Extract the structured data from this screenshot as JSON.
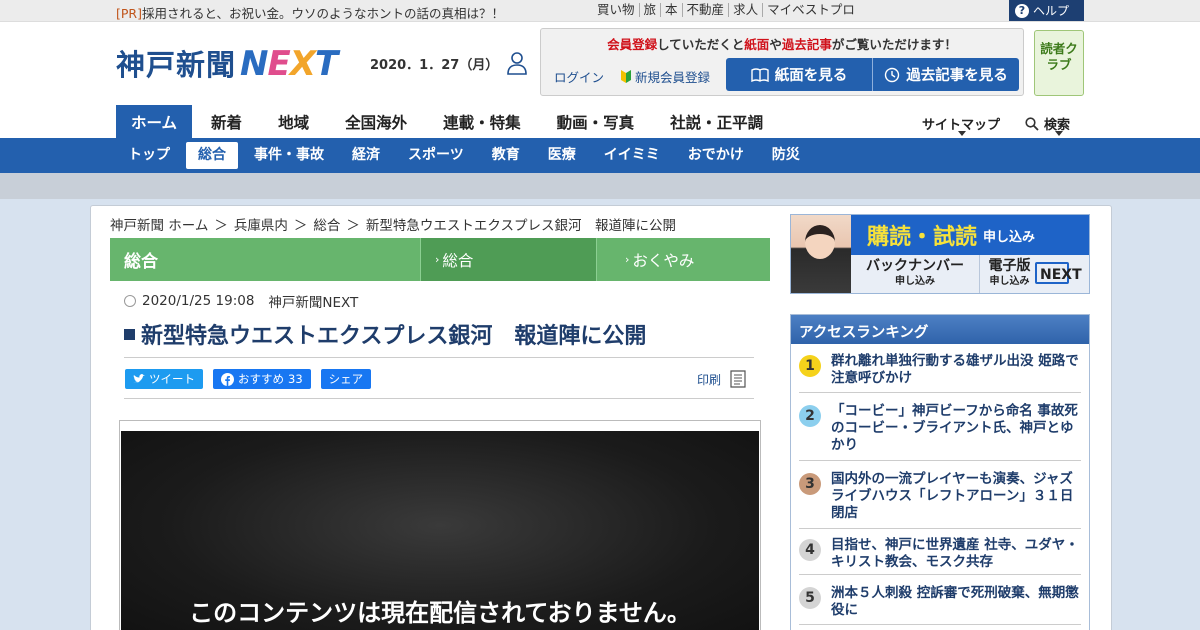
{
  "topbar": {
    "pr_tag": "[PR]",
    "pr_text": "採用されると、お祝い金。ウソのようなホントの話の真相は？！",
    "links": [
      "買い物",
      "旅",
      "本",
      "不動産",
      "求人",
      "マイベストプロ"
    ],
    "help": "ヘルプ"
  },
  "header": {
    "logo_jp": "神戸新聞",
    "logo_next": [
      "N",
      "E",
      "X",
      "T"
    ],
    "date": "2020．1．27（月）",
    "member_msg": [
      "会員登録",
      "していただくと",
      "紙面",
      "や",
      "過去記事",
      "がご覧いただけます！"
    ],
    "login": "ログイン",
    "new_member": "新規会員登録",
    "view_paper": "紙面を見る",
    "view_past": "過去記事を見る",
    "club": "読者クラブ",
    "colors": {
      "brand": "#2360ae",
      "accent": "#d0121b",
      "club": "#3c7a1a"
    }
  },
  "mainnav": {
    "items": [
      "ホーム",
      "新着",
      "地域",
      "全国海外",
      "連載・特集",
      "動画・写真",
      "社説・正平調"
    ],
    "sitemap": "サイトマップ",
    "search": "検索"
  },
  "subnav": {
    "items": [
      "トップ",
      "総合",
      "事件・事故",
      "経済",
      "スポーツ",
      "教育",
      "医療",
      "イイミミ",
      "おでかけ",
      "防災"
    ]
  },
  "breadcrumb": [
    "神戸新聞 ホーム",
    "兵庫県内",
    "総合",
    "新型特急ウエストエクスプレス銀河　報道陣に公開"
  ],
  "category": {
    "main": "総合",
    "tabs": [
      "総合",
      "おくやみ"
    ]
  },
  "article": {
    "datetime": "2020/1/25 19:08",
    "source": "神戸新聞NEXT",
    "title": "新型特急ウエストエクスプレス銀河　報道陣に公開",
    "share": {
      "tweet": "ツイート",
      "recommend": "おすすめ",
      "recommend_count": "33",
      "share": "シェア"
    },
    "print": "印刷",
    "video_message": "このコンテンツは現在配信されておりません。"
  },
  "sidebar": {
    "ad": {
      "main": "購読・試読",
      "main_sub": "申し込み",
      "backnumber": "バックナンバー",
      "backnumber_sub": "申し込み",
      "edition": "電子版",
      "edition_sub": "申し込み",
      "next_badge": "NEXT"
    },
    "ranking_title": "アクセスランキング",
    "ranking": [
      {
        "rank": "1",
        "text": "群れ離れ単独行動する雄ザル出没 姫路で注意呼びかけ",
        "color": "#f5d21b"
      },
      {
        "rank": "2",
        "text": "「コービー」神戸ビーフから命名 事故死のコービー・ブライアント氏、神戸とゆかり",
        "color": "#8ccfee"
      },
      {
        "rank": "3",
        "text": "国内外の一流プレイヤーも演奏、ジャズライブハウス「レフトアローン」３１日閉店",
        "color": "#c99a7a"
      },
      {
        "rank": "4",
        "text": "目指せ、神戸に世界遺産 社寺、ユダヤ・キリスト教会、モスク共存",
        "color": "#d4d4d4"
      },
      {
        "rank": "5",
        "text": "洲本５人刺殺 控訴審で死刑破棄、無期懲役に",
        "color": "#d4d4d4"
      }
    ]
  }
}
